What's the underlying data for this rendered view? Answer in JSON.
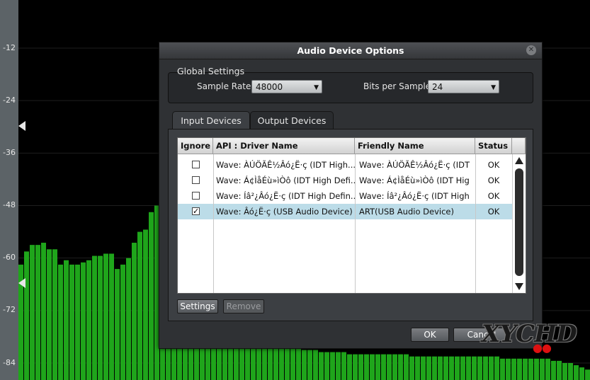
{
  "analyzer": {
    "axis_labels": [
      "-12",
      "-24",
      "-36",
      "-48",
      "-60",
      "-72",
      "-84"
    ],
    "bar_color": "#1fa51b",
    "bar_levels": [
      -61.5,
      -58.5,
      -57,
      -57,
      -56.5,
      -58,
      -58,
      -61.5,
      -60.5,
      -61.5,
      -61.5,
      -61,
      -60.5,
      -59.5,
      -59.5,
      -59,
      -59,
      -62.5,
      -61.5,
      -60,
      -56.5,
      -54,
      -53.5,
      -49.5,
      -48,
      -46,
      -49.5,
      -49.5,
      -56,
      -59,
      -57.5,
      -60,
      -60,
      -60,
      -62,
      -64,
      -66,
      -68,
      -70,
      -71,
      -72,
      -73,
      -74,
      -75,
      -76,
      -77,
      -78,
      -79,
      -80,
      -80.5,
      -81,
      -81,
      -81,
      -81.5,
      -81.5,
      -81.5,
      -81.5,
      -81.5,
      -82,
      -82,
      -82,
      -82,
      -82,
      -82,
      -82,
      -82,
      -82,
      -82,
      -82,
      -82.5,
      -82.5,
      -82.5,
      -82.5,
      -82.5,
      -82.5,
      -82.5,
      -82.5,
      -82.5,
      -82.5,
      -82.5,
      -82.5,
      -82.5,
      -82.5,
      -82.5,
      -82.5,
      -83,
      -83,
      -83,
      -83,
      -83,
      -83,
      -83,
      -83,
      -83,
      -83.5,
      -83.5,
      -84,
      -84,
      -84.5,
      -85,
      -85.5,
      -85
    ]
  },
  "dialog": {
    "title": "Audio Device Options",
    "close_icon": "close-icon",
    "global_settings": {
      "title": "Global Settings",
      "sample_rate_label": "Sample Rate:",
      "sample_rate_value": "48000",
      "bits_label": "Bits per Sample:",
      "bits_value": "24"
    },
    "tabs": [
      {
        "label": "Input Devices",
        "active": true
      },
      {
        "label": "Output Devices",
        "active": false
      }
    ],
    "table": {
      "columns": [
        "Ignore",
        "API : Driver Name",
        "Friendly Name",
        "Status"
      ],
      "rows": [
        {
          "ignored": false,
          "driver": "Wave: ÀÚÖÃÊ½Âó¿Ë·ç (IDT High...",
          "friendly": "Wave: ÀÚÖÃÊ½Âó¿Ë·ç (IDT",
          "status": "OK",
          "selected": false
        },
        {
          "ignored": false,
          "driver": "Wave: Á¢ÌåÉù»ìÒô (IDT High Defi...",
          "friendly": "Wave: Á¢ÌåÉù»ìÒô (IDT Hig",
          "status": "OK",
          "selected": false
        },
        {
          "ignored": false,
          "driver": "Wave: Íâ²¿Âó¿Ë·ç (IDT High Defin...",
          "friendly": "Wave: Íâ²¿Âó¿Ë·ç (IDT High",
          "status": "OK",
          "selected": false
        },
        {
          "ignored": true,
          "driver": "Wave: Âó¿Ë·ç (USB Audio Device)",
          "friendly": "ART(USB Audio Device)",
          "status": "OK",
          "selected": true
        }
      ]
    },
    "settings_button": "Settings",
    "remove_button": "Remove",
    "ok_button": "OK",
    "cancel_button": "Cancel"
  },
  "watermark": "XYCHD"
}
